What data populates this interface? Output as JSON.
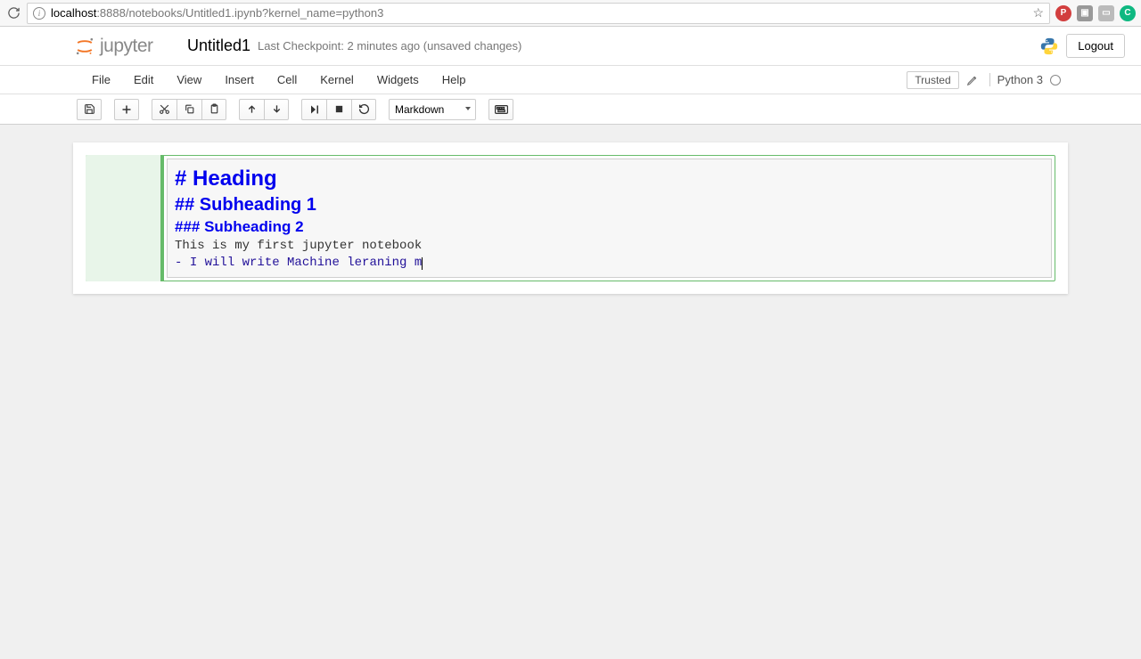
{
  "browser": {
    "url_prefix": "localhost",
    "url_rest": ":8888/notebooks/Untitled1.ipynb?kernel_name=python3"
  },
  "header": {
    "logo_text": "jupyter",
    "title": "Untitled1",
    "checkpoint": "Last Checkpoint: 2 minutes ago (unsaved changes)",
    "logout": "Logout"
  },
  "menubar": {
    "items": [
      "File",
      "Edit",
      "View",
      "Insert",
      "Cell",
      "Kernel",
      "Widgets",
      "Help"
    ],
    "trusted": "Trusted",
    "kernel": "Python 3"
  },
  "toolbar": {
    "cell_type": "Markdown"
  },
  "cell": {
    "lines": {
      "h1": "# Heading",
      "h2": "## Subheading 1",
      "h3": "### Subheading 2",
      "text": "This is my first jupyter notebook",
      "li_marker": "- ",
      "li_text": "I will write Machine leraning m"
    }
  }
}
